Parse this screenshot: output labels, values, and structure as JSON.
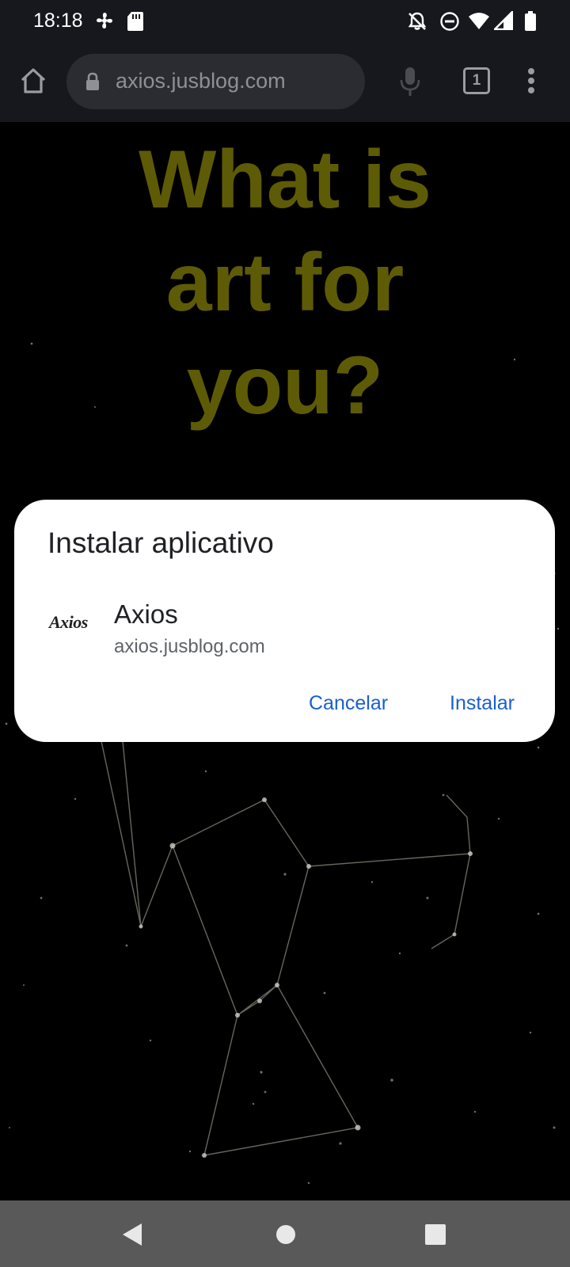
{
  "status_bar": {
    "time": "18:18",
    "icons": [
      "fan-icon",
      "sd-card-icon",
      "notifications-off-icon",
      "do-not-disturb-icon",
      "wifi-icon",
      "signal-icon",
      "battery-icon"
    ]
  },
  "browser": {
    "url": "axios.jusblog.com",
    "tab_count": "1",
    "icons": [
      "home-icon",
      "lock-icon",
      "microphone-icon",
      "tab-switcher-icon",
      "more-menu-icon"
    ]
  },
  "page": {
    "headline_line1": "What is",
    "headline_line2": "art for",
    "headline_line3": "you?",
    "headline_color": "#5e5b06"
  },
  "install_dialog": {
    "title": "Instalar aplicativo",
    "app_logo_text": "Axios",
    "app_name": "Axios",
    "app_url": "axios.jusblog.com",
    "cancel_label": "Cancelar",
    "install_label": "Instalar",
    "accent_color": "#1a5fcf"
  },
  "nav_bar": {
    "icons": [
      "back-icon",
      "home-circle-icon",
      "recents-icon"
    ]
  }
}
